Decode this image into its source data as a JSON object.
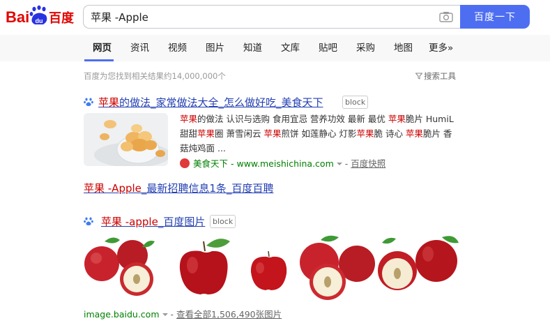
{
  "logo": {
    "text_left": "Bai",
    "text_paw": "du",
    "text_right": "百度"
  },
  "search": {
    "query": "苹果 -Apple",
    "button_label": "百度一下"
  },
  "tabs": [
    {
      "label": "网页",
      "active": true
    },
    {
      "label": "资讯"
    },
    {
      "label": "视频"
    },
    {
      "label": "图片"
    },
    {
      "label": "知道"
    },
    {
      "label": "文库"
    },
    {
      "label": "贴吧"
    },
    {
      "label": "采购"
    },
    {
      "label": "地图"
    },
    {
      "label": "更多»"
    }
  ],
  "stats": {
    "text": "百度为您找到相关结果约14,000,000个",
    "tools_label": "搜索工具"
  },
  "results": {
    "r1": {
      "title_hl": "苹果",
      "title_rest": "的做法_家常做法大全_怎么做好吃_美食天下",
      "block_label": "block",
      "snippet": [
        {
          "t": "苹果",
          "hl": true
        },
        {
          "t": "的做法 认识与选购 食用宜忌 营养功效 最新 最优 "
        },
        {
          "t": "苹果",
          "hl": true
        },
        {
          "t": "脆片 HumiL 甜甜"
        },
        {
          "t": "苹果",
          "hl": true
        },
        {
          "t": "圈 萧雪闲云 "
        },
        {
          "t": "苹果",
          "hl": true
        },
        {
          "t": "煎饼 如莲静心 灯影"
        },
        {
          "t": "苹果",
          "hl": true
        },
        {
          "t": "脆 诗心 "
        },
        {
          "t": "苹果",
          "hl": true
        },
        {
          "t": "脆片 香菇炖鸡面 ..."
        }
      ],
      "source_name": "美食天下",
      "source_url": "- www.meishichina.com",
      "cache_label": "百度快照"
    },
    "r2": {
      "title_hl": "苹果 -Apple",
      "title_rest": "_最新招聘信息1条_百度百聘"
    },
    "r3": {
      "title_hl": "苹果 -apple",
      "title_rest": "_百度图片",
      "block_label": "block",
      "footer_domain": "image.baidu.com",
      "footer_more": "查看全部1,506,490张图片"
    }
  },
  "colors": {
    "accent": "#4e6ef2",
    "highlight": "#c00",
    "link": "#2440b3",
    "url_green": "#008000"
  },
  "icons": [
    "baidu-paw-icon",
    "camera-icon",
    "funnel-icon",
    "paw-badge-icon",
    "caret-down-icon"
  ]
}
